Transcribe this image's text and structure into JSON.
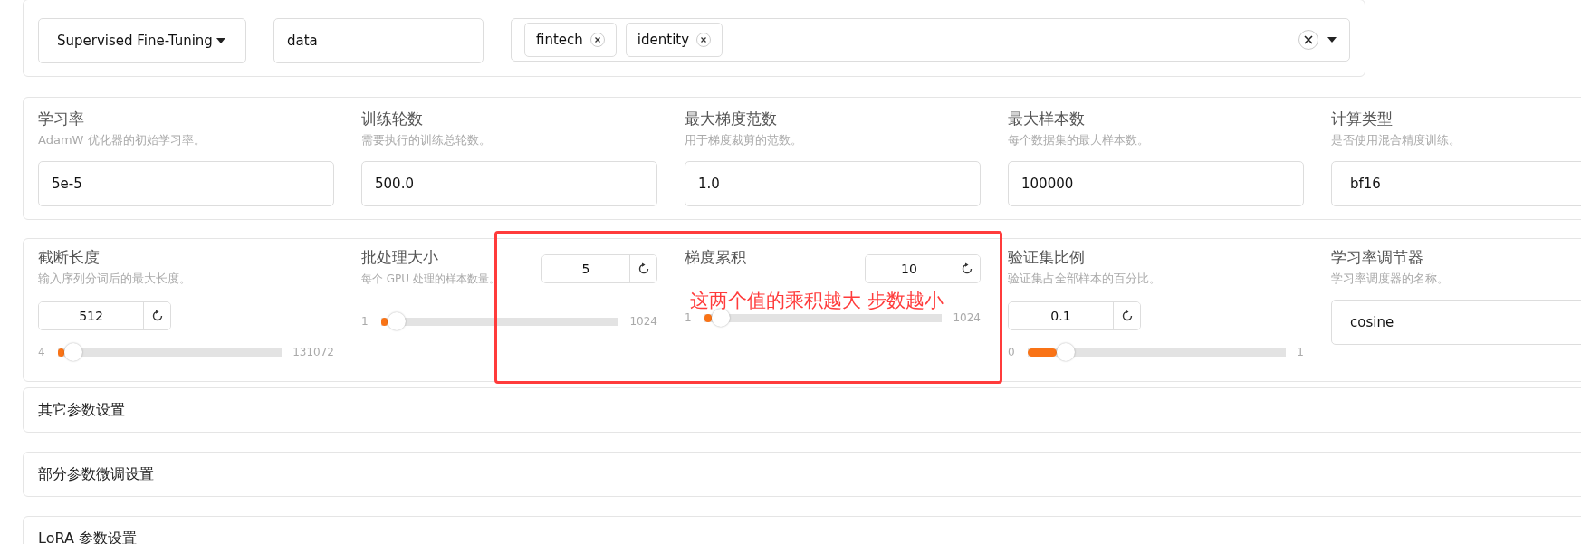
{
  "top_row": {
    "fields": [
      {
        "kind": "dropdown",
        "value": "Supervised Fine-Tuning"
      },
      {
        "kind": "textbox",
        "value": "data"
      },
      {
        "kind": "multiselect",
        "tags": [
          "fintech",
          "identity"
        ]
      }
    ]
  },
  "params_row": {
    "fields": [
      {
        "kind": "textbox",
        "label": "学习率",
        "hint": "AdamW 优化器的初始学习率。",
        "value": "5e-5"
      },
      {
        "kind": "textbox",
        "label": "训练轮数",
        "hint": "需要执行的训练总轮数。",
        "value": "500.0"
      },
      {
        "kind": "textbox",
        "label": "最大梯度范数",
        "hint": "用于梯度裁剪的范数。",
        "value": "1.0"
      },
      {
        "kind": "textbox",
        "label": "最大样本数",
        "hint": "每个数据集的最大样本数。",
        "value": "100000"
      },
      {
        "kind": "select",
        "label": "计算类型",
        "hint": "是否使用混合精度训练。",
        "value": "bf16"
      }
    ]
  },
  "slider_row": {
    "fields": [
      {
        "kind": "numberslider",
        "label": "截断长度",
        "hint": "输入序列分词后的最大长度。",
        "value": "512",
        "min": "4",
        "max": "131072",
        "level": 0.004
      },
      {
        "kind": "slider",
        "label": "批处理大小",
        "hint": "每个 GPU 处理的样本数量。",
        "value": "5",
        "min": "1",
        "max": "1024",
        "level": 0.004
      },
      {
        "kind": "slider",
        "label": "梯度累积",
        "value": "10",
        "min": "1",
        "max": "1024",
        "level": 0.009
      },
      {
        "kind": "numberslider",
        "label": "验证集比例",
        "hint": "验证集占全部样本的百分比。",
        "value": "0.1",
        "min": "0",
        "max": "1",
        "level": 0.1
      },
      {
        "kind": "select",
        "label": "学习率调节器",
        "hint": "学习率调度器的名称。",
        "value": "cosine"
      }
    ]
  },
  "accordions": [
    {
      "title": "其它参数设置"
    },
    {
      "title": "部分参数微调设置"
    },
    {
      "title": "LoRA 参数设置"
    }
  ],
  "annotation": {
    "text": "这两个值的乘积越大 步数越小"
  }
}
